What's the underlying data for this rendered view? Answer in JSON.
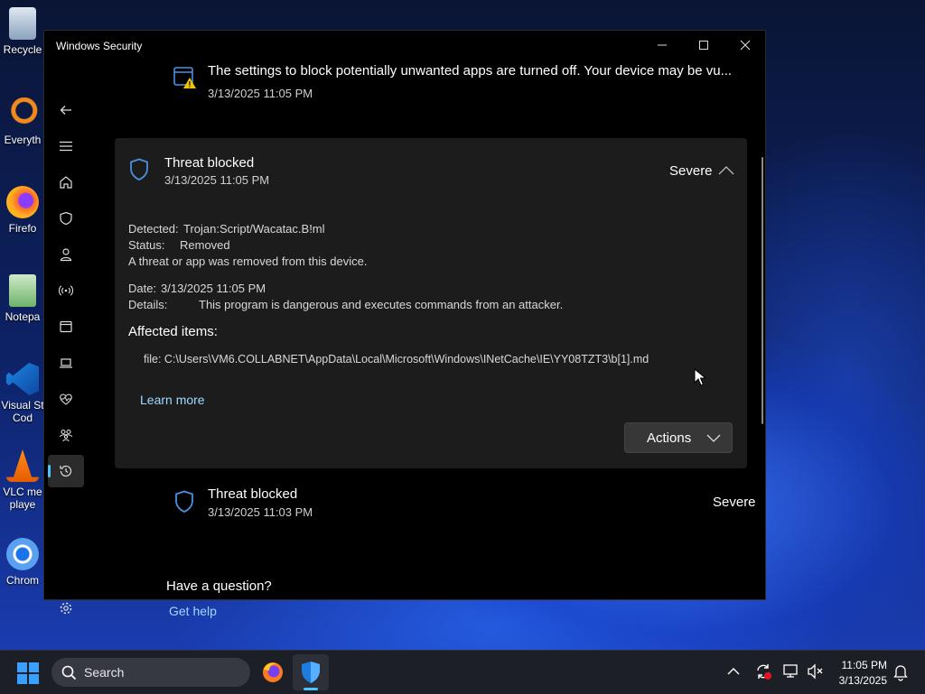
{
  "desktop": {
    "icons": [
      {
        "label": "Recycle",
        "name": "desktop-recycle-bin"
      },
      {
        "label": "Everyth",
        "name": "desktop-everything"
      },
      {
        "label": "Firefo",
        "name": "desktop-firefox"
      },
      {
        "label": "Notepa",
        "name": "desktop-notepad"
      },
      {
        "label": "Visual St",
        "label2": "Cod",
        "name": "desktop-vscode"
      },
      {
        "label": "VLC me",
        "label2": "playe",
        "name": "desktop-vlc"
      },
      {
        "label": "Chrom",
        "name": "desktop-chrome"
      }
    ]
  },
  "window": {
    "title": "Windows Security",
    "accent": "#4cc2ff",
    "severity_shield_color": "#4a90e2"
  },
  "history": {
    "top_item": {
      "title": "The settings to block potentially unwanted apps are turned off. Your device may be vu...",
      "date": "3/13/2025 11:05 PM"
    },
    "expanded_item": {
      "title": "Threat blocked",
      "date": "3/13/2025 11:05 PM",
      "severity": "Severe",
      "detected_label": "Detected:",
      "detected_value": "Trojan:Script/Wacatac.B!ml",
      "status_label": "Status:",
      "status_value": "Removed",
      "status_message": "A threat or app was removed from this device.",
      "date_label": "Date:",
      "date_value": "3/13/2025 11:05 PM",
      "details_label": "Details:",
      "details_value": "This program is dangerous and executes commands from an attacker.",
      "affected_heading": "Affected items:",
      "affected_file": "file: C:\\Users\\VM6.COLLABNET\\AppData\\Local\\Microsoft\\Windows\\INetCache\\IE\\YY08TZT3\\b[1].md",
      "learn_more": "Learn more",
      "actions_label": "Actions"
    },
    "second_item": {
      "title": "Threat blocked",
      "date": "3/13/2025 11:03 PM",
      "severity": "Severe"
    }
  },
  "help": {
    "question": "Have a question?",
    "get_help": "Get help"
  },
  "taskbar": {
    "search_placeholder": "Search",
    "time": "11:05 PM",
    "date": "3/13/2025"
  }
}
